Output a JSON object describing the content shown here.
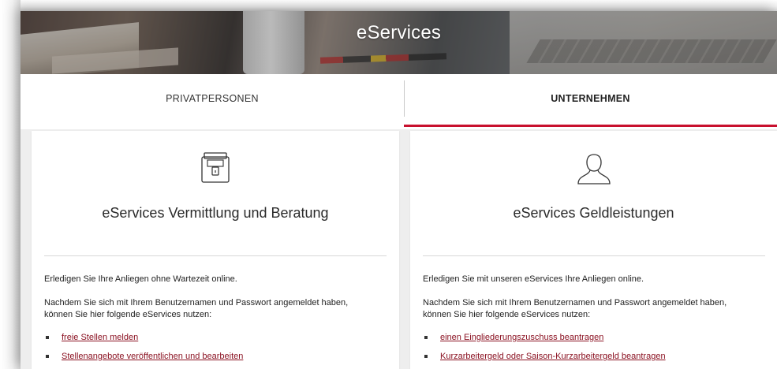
{
  "hero": {
    "title": "eServices"
  },
  "tabs": [
    {
      "label": "PRIVATPERSONEN",
      "active": false
    },
    {
      "label": "UNTERNEHMEN",
      "active": true
    }
  ],
  "colors": {
    "accent": "#c8102e",
    "link": "#8b1222"
  },
  "cards": [
    {
      "icon": "briefcase-icon",
      "title": "eServices Vermittlung und Beratung",
      "intro": "Erledigen Sie Ihre Anliegen ohne Wartezeit online.",
      "text": "Nachdem Sie sich mit Ihrem Benutzernamen und Passwort angemeldet haben, können Sie hier folgende eServices nutzen:",
      "links": [
        "freie Stellen melden",
        "Stellenangebote veröffentlichen und bearbeiten"
      ]
    },
    {
      "icon": "user-icon",
      "title": "eServices Geldleistungen",
      "intro": "Erledigen Sie mit unseren eServices Ihre Anliegen online.",
      "text": "Nachdem Sie sich mit Ihrem Benutzernamen und Passwort angemeldet haben, können Sie hier folgende eServices nutzen:",
      "links": [
        "einen Eingliederungszuschuss beantragen",
        "Kurzarbeitergeld oder Saison-Kurzarbeitergeld beantragen"
      ]
    }
  ]
}
